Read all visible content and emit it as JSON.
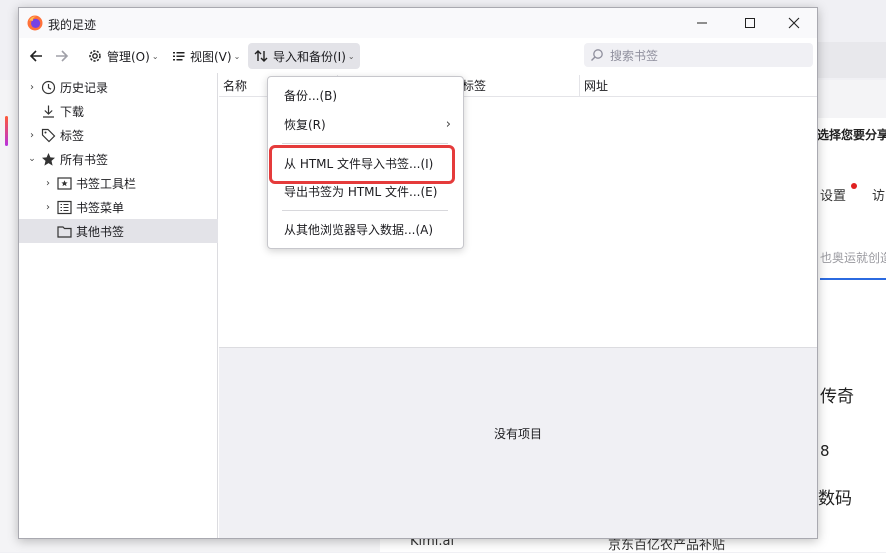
{
  "window": {
    "title": "我的足迹"
  },
  "toolbar": {
    "manage_label": "管理(O)",
    "view_label": "视图(V)",
    "import_label": "导入和备份(I)",
    "search_placeholder": "搜索书签"
  },
  "tree": {
    "items": [
      {
        "label": "历史记录"
      },
      {
        "label": "下载"
      },
      {
        "label": "标签"
      },
      {
        "label": "所有书签"
      },
      {
        "label": "书签工具栏"
      },
      {
        "label": "书签菜单"
      },
      {
        "label": "其他书签"
      }
    ]
  },
  "list": {
    "columns": [
      "名称",
      "标签",
      "网址"
    ],
    "empty_text": "没有项目"
  },
  "menu": {
    "items": [
      {
        "label": "备份...(B)"
      },
      {
        "label": "恢复(R)"
      },
      {
        "label": "从 HTML 文件导入书签...(I)"
      },
      {
        "label": "导出书签为 HTML 文件...(E)"
      },
      {
        "label": "从其他浏览器导入数据...(A)"
      }
    ]
  },
  "background": {
    "share_text": "选择您要分享",
    "settings_text": "设置",
    "visit_text": "访",
    "placeholder_text": "也奥运就创造",
    "legend_text": "传奇",
    "number_text": "8",
    "code_text": "数码",
    "kimi_text": "Kimi.ai",
    "jd_text": "京东百亿农产品补贴"
  },
  "colors": {
    "highlight": "#e53b3b",
    "accent_blue": "#2b6ae0",
    "notification_dot": "#e02020"
  }
}
